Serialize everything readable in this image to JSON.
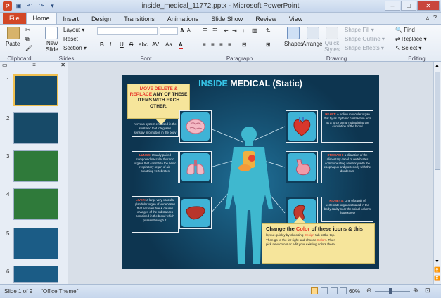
{
  "window": {
    "title": "inside_medical_11772.pptx - Microsoft PowerPoint",
    "app_letter": "P"
  },
  "tabs": [
    "File",
    "Home",
    "Insert",
    "Design",
    "Transitions",
    "Animations",
    "Slide Show",
    "Review",
    "View"
  ],
  "ribbon": {
    "clipboard": {
      "paste": "Paste",
      "label": "Clipboard"
    },
    "slides": {
      "new_slide": "New Slide",
      "layout": "Layout ▾",
      "reset": "Reset",
      "section": "Section ▾",
      "label": "Slides"
    },
    "font": {
      "bold": "B",
      "italic": "I",
      "underline": "U",
      "strike": "S",
      "shadow": "abc",
      "spacing": "AV",
      "case": "Aa",
      "color": "A",
      "label": "Font"
    },
    "paragraph": {
      "label": "Paragraph"
    },
    "drawing": {
      "shapes": "Shapes",
      "arrange": "Arrange",
      "quick_styles": "Quick Styles",
      "shape_fill": "Shape Fill ▾",
      "shape_outline": "Shape Outline ▾",
      "shape_effects": "Shape Effects ▾",
      "label": "Drawing"
    },
    "editing": {
      "find": "Find",
      "replace": "Replace ▾",
      "select": "Select ▾",
      "label": "Editing"
    }
  },
  "slide_panel": {
    "numbers": [
      "1",
      "2",
      "3",
      "4",
      "5",
      "6"
    ]
  },
  "slide": {
    "title_part1": "INSIDE",
    "title_part2": " MEDICAL (Static)",
    "callout_top": {
      "line1": "MOVE DELETE &",
      "line2a": "REPLACE",
      "line2b": " ANY OF THESE",
      "line3": "ITEMS WITH EACH",
      "line4": "OTHER."
    },
    "brain_text": "nervous system enclosed in the skull and that integrates sensory information in the body",
    "lungs_text_hl": "LUNGS:",
    "lungs_text": " Usually paired compound saccular thoracic organs that constitute the basic respiratory organ of air-breathing vertebrates",
    "liver_text_hl": "LIVER:",
    "liver_text": " a large very vascular glandular organ of vertebrates that secretes bile & causes changes of the substances contained in the blood which passes through it.",
    "heart_text_hl": "HEART:",
    "heart_text": " A hollow muscular organ that by its rhythmic contraction acts as a force pump maintaining the circulation of the blood",
    "stomach_text_hl": "STOMACH:",
    "stomach_text": " a dilatation of the alimentary canal of vertebrates communicating anteriorly with the esophagus and posteriorly with the duodenum",
    "kidney_text_hl": "KIDNEYS:",
    "kidney_text": " One of a pair of vertebrate organs situated in the body cavity near the spinal column that excrete",
    "callout_bottom": {
      "big1": "Change the ",
      "big2": "Color",
      "big3": " of these icons & this",
      "line2a": "layout quickly by choosing ",
      "line2b": "Design",
      "line2c": " tab at the top.",
      "line3a": "Then go to the far right and choose ",
      "line3b": "Colors",
      "line3c": ". Then",
      "line4": "pick new colors or edit your existing colors there."
    }
  },
  "status": {
    "slide": "Slide 1 of 9",
    "theme": "\"Office Theme\"",
    "zoom": "60%"
  },
  "colors": {
    "file_tab": "#d24726",
    "slide_bg": "#0d3550",
    "accent": "#37c5e8",
    "highlight": "#e8362a",
    "callout": "#f6e59b"
  }
}
